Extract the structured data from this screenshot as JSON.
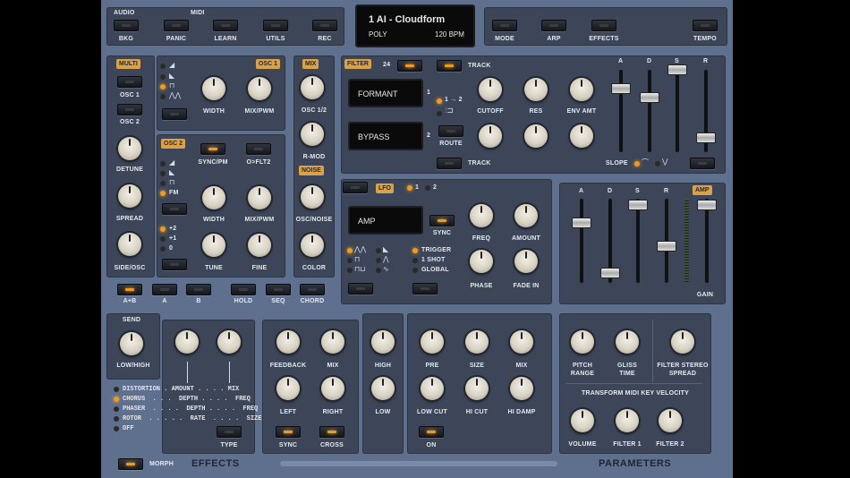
{
  "top": {
    "audio": "AUDIO",
    "midi": "MIDI",
    "bkg": "BKG",
    "panic": "PANIC",
    "learn": "LEARN",
    "utils": "UTILS",
    "rec": "REC",
    "preset": "1 AI - Cloudform",
    "mode_text": "POLY",
    "bpm_text": "120 BPM",
    "mode": "MODE",
    "arp": "ARP",
    "effects": "EFFECTS",
    "tempo": "TEMPO"
  },
  "osc": {
    "multi": "MULTI",
    "osc1": "OSC 1",
    "osc2": "OSC 2",
    "detune": "DETUNE",
    "spread": "SPREAD",
    "side_osc": "SIDE/OSC",
    "osc1_tag": "OSC 1",
    "width": "WIDTH",
    "mix_pwm": "MIX/PWM",
    "osc2_tag": "OSC 2",
    "sync_pm": "SYNC/PM",
    "ofl2": "O>FLT2",
    "fm": "FM",
    "width2": "WIDTH",
    "mix_pwm2": "MIX/PWM",
    "tune": "TUNE",
    "fine": "FINE",
    "p2": "+2",
    "p1": "+1",
    "p0": "0"
  },
  "mix": {
    "tag": "MIX",
    "osc12": "OSC 1/2",
    "rmod": "R-MOD",
    "noise_tag": "NOISE",
    "osc_noise": "OSC/NOISE",
    "color": "COLOR"
  },
  "bottom_btns": {
    "ab": "A+B",
    "a": "A",
    "b": "B",
    "hold": "HOLD",
    "seq": "SEQ",
    "chord": "CHORD"
  },
  "filter": {
    "tag": "FILTER",
    "slope_num": "24",
    "track": "TRACK",
    "track2": "TRACK",
    "f1": "FORMANT",
    "f2": "BYPASS",
    "n1": "1",
    "n2": "2",
    "route_a": "1 → 2",
    "route": "ROUTE",
    "cutoff": "CUTOFF",
    "res": "RES",
    "env_amt": "ENV AMT",
    "a": "A",
    "d": "D",
    "s": "S",
    "r": "R",
    "slope": "SLOPE"
  },
  "lfo": {
    "tag": "LFO",
    "one": "1",
    "two": "2",
    "dest": "AMP",
    "sync": "SYNC",
    "freq": "FREQ",
    "amount": "AMOUNT",
    "phase": "PHASE",
    "fade_in": "FADE IN",
    "trigger": "TRIGGER",
    "oneshot": "1 SHOT",
    "global": "GLOBAL"
  },
  "amp": {
    "tag": "AMP",
    "a": "A",
    "d": "D",
    "s": "S",
    "r": "R",
    "gain": "GAIN"
  },
  "fx": {
    "send": "SEND",
    "low_high": "LOW/HIGH",
    "rows": [
      "DISTORTION . AMOUNT . . . . MIX",
      "CHORUS  . . .  DEPTH . . . .  FREQ",
      "PHASER  . . . .  DEPTH . . . .  FREQ",
      "ROTOR  . . . . .  RATE  . . . .  SIZE",
      "OFF"
    ],
    "type": "TYPE",
    "morph": "MORPH",
    "effects": "EFFECTS"
  },
  "delay": {
    "feedback": "FEEDBACK",
    "mix": "MIX",
    "left": "LEFT",
    "right": "RIGHT",
    "sync": "SYNC",
    "cross": "CROSS",
    "high": "HIGH",
    "low": "LOW"
  },
  "reverb": {
    "pre": "PRE",
    "size": "SIZE",
    "mix": "MIX",
    "low_cut": "LOW CUT",
    "hi_cut": "HI CUT",
    "hi_damp": "HI DAMP",
    "on": "ON"
  },
  "params": {
    "pitch_range": "PITCH RANGE",
    "gliss_time": "GLISS TIME",
    "filter_stereo": "FILTER STEREO SPREAD",
    "velocity": "TRANSFORM MIDI KEY VELOCITY",
    "volume": "VOLUME",
    "filter1": "FILTER 1",
    "filter2": "FILTER 2",
    "title": "PARAMETERS"
  }
}
